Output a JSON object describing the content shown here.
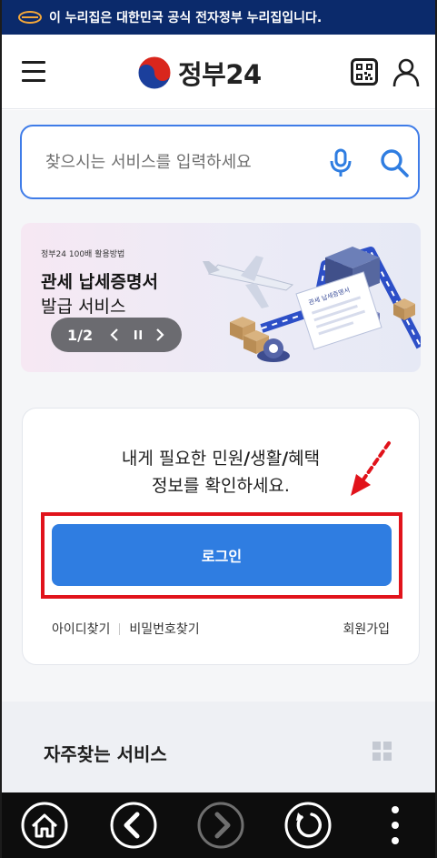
{
  "gov_banner": {
    "text": "이 누리집은 대한민국 공식 전자정부 누리집입니다."
  },
  "header": {
    "logo_text": "정부24"
  },
  "search": {
    "placeholder": "찾으시는 서비스를 입력하세요"
  },
  "promo": {
    "small_label": "정부24 100배 활용방법",
    "title_line1": "관세 납세증명서",
    "title_line2": "발급 서비스",
    "pager_text": "1/2",
    "doc_label": "관세 납세증명서"
  },
  "login_card": {
    "message_prefix": "내게 필요한 민원",
    "slash1": "/",
    "message_mid": "생활",
    "slash2": "/",
    "message_suffix": "혜택",
    "message_line2": "정보를 확인하세요.",
    "login_label": "로그인",
    "find_id": "아이디찾기",
    "find_password": "비밀번호찾기",
    "signup": "회원가입"
  },
  "faq": {
    "title": "자주찾는 서비스"
  },
  "colors": {
    "gov_banner": "#0b2a6b",
    "accent_blue": "#2f7de1",
    "highlight_red": "#e1131b"
  },
  "icons": [
    "menu-icon",
    "qr-code-icon",
    "user-icon",
    "microphone-icon",
    "search-icon",
    "home-icon",
    "back-icon",
    "forward-icon",
    "refresh-icon",
    "more-icon",
    "grid-icon"
  ]
}
